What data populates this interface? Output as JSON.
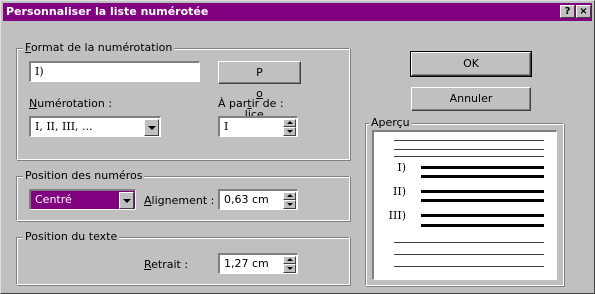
{
  "window": {
    "title": "Personnaliser la liste numérotée",
    "help_btn": "?",
    "close_btn": "×"
  },
  "format_group": {
    "label_pre": "",
    "label_u": "F",
    "label_post": "ormat de la numérotation",
    "value": "I)",
    "police_pre": "P",
    "police_u": "o",
    "police_post": "lice..."
  },
  "numerotation": {
    "label_u": "N",
    "label_post": "umérotation :",
    "value": "I, II, III, ..."
  },
  "start": {
    "label_pre": "À par",
    "label_u": "t",
    "label_post": "ir de :",
    "value": "I"
  },
  "position_numbers": {
    "label": "Position des numéros",
    "alignment_value": "Centré",
    "alignment_label_pre": "",
    "alignment_label_u": "A",
    "alignment_label_post": "lignement :",
    "alignment_measure": "0,63 cm"
  },
  "position_text": {
    "label": "Position du texte",
    "indent_label_u": "R",
    "indent_label_post": "etrait :",
    "indent_value": "1,27 cm"
  },
  "buttons": {
    "ok": "OK",
    "cancel": "Annuler"
  },
  "preview": {
    "label": "Aperçu",
    "numbers": [
      "I)",
      "II)",
      "III)"
    ]
  },
  "colors": {
    "titlebar": "#800080",
    "selection": "#800080",
    "face": "#c0c0c0"
  }
}
